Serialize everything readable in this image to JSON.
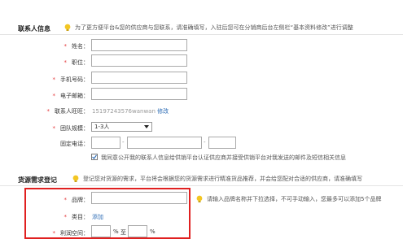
{
  "contact": {
    "title": "联系人信息",
    "hint": "为了更方便平台&您的供应商与您联系，请准确填写，入驻后您可在分销商后台左侧栏“基本资料修改”进行调整",
    "name_label": "姓名：",
    "position_label": "职位：",
    "mobile_label": "手机号码：",
    "email_label": "电子邮箱：",
    "account_label": "联系人旺旺：",
    "account_value": "15197243576wanwan",
    "account_edit": "修改",
    "team_label": "团队规模：",
    "team_value": "1-3人",
    "phone_label": "固定电话：",
    "agree_text": "我同意公开我的联系人信息给供销平台认证供应商并接受供销平台对我发送的邮件及短信相关信息"
  },
  "supply": {
    "title": "货源需求登记",
    "hint": "登记您对货源的需求，平台将会根据您的货源需求进行精准货品推荐，并会给您配对合适的供应商，请准确填写",
    "brand_label": "品牌：",
    "brand_hint": "请输入品牌名称并下拉选择，不可手动输入，您最多可以添加5个品牌",
    "category_label": "类目：",
    "category_add": "添加",
    "profit_label": "利润空间：",
    "percent": "%",
    "to": "至"
  },
  "colors": {
    "required": "#e4393c",
    "link": "#2d6cb5",
    "highlight": "#e02020",
    "bulb": "#f3c623"
  }
}
